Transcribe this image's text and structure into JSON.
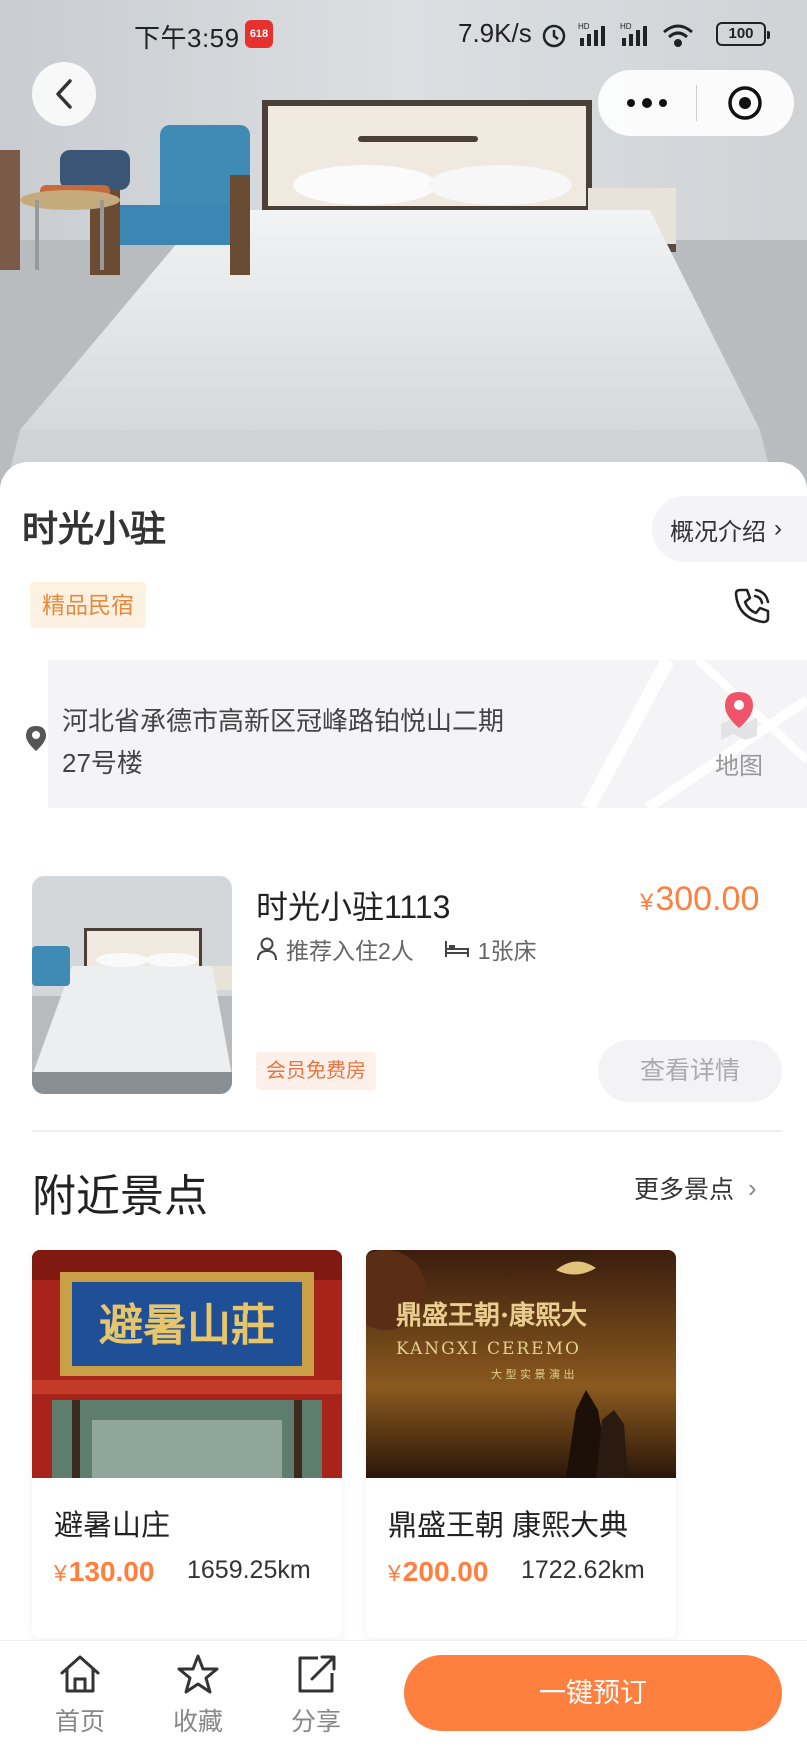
{
  "status_bar": {
    "time": "下午3:59",
    "badge": "618",
    "net_speed": "7.9K/s",
    "battery": "100"
  },
  "header": {
    "hotel_name": "时光小驻",
    "intro_label": "概况介绍",
    "tag": "精品民宿"
  },
  "location": {
    "address_line1": "河北省承德市高新区冠峰路铂悦山二期",
    "address_line2": "27号楼",
    "map_label": "地图"
  },
  "room": {
    "name": "时光小驻1113",
    "currency": "¥",
    "price": "300.00",
    "occupancy": "推荐入住2人",
    "beds": "1张床",
    "member_tag": "会员免费房",
    "detail_label": "查看详情"
  },
  "nearby": {
    "title": "附近景点",
    "more_label": "更多景点",
    "spots": [
      {
        "name": "避暑山庄",
        "currency": "¥",
        "price": "130.00",
        "distance": "1659.25km",
        "plaque_text": "避暑山莊"
      },
      {
        "name": "鼎盛王朝 康熙大典",
        "currency": "¥",
        "price": "200.00",
        "distance": "1722.62km",
        "poster_title": "鼎盛王朝·康熙大",
        "poster_sub": "KANGXI CEREMO",
        "poster_tag": "大 型 实 景 演 出"
      }
    ]
  },
  "bottom_nav": {
    "home": "首页",
    "favorite": "收藏",
    "share": "分享",
    "book": "一键预订"
  },
  "colors": {
    "accent": "#ff7f3f",
    "tag_text": "#e88a3b",
    "tag_bg": "#fdf1e4",
    "pin": "#f0546a"
  }
}
